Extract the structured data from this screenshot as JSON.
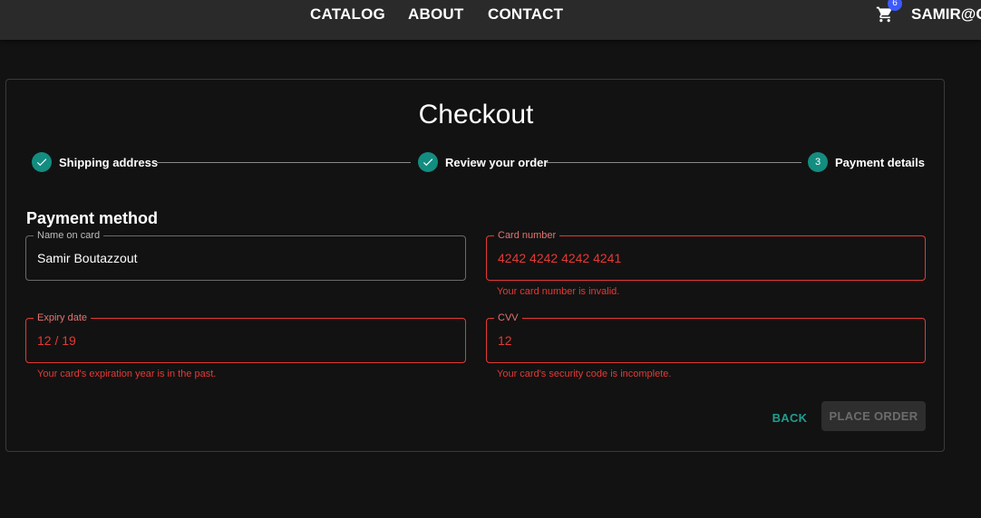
{
  "nav": {
    "links": [
      "CATALOG",
      "ABOUT",
      "CONTACT"
    ],
    "cart_count": "6",
    "cart_icon": "shopping-cart-icon",
    "user": "SAMIR@G"
  },
  "checkout": {
    "title": "Checkout",
    "steps": [
      {
        "label": "Shipping address",
        "state": "completed",
        "icon": "check-icon"
      },
      {
        "label": "Review your order",
        "state": "completed",
        "icon": "check-icon"
      },
      {
        "label": "Payment details",
        "state": "active",
        "number": "3"
      }
    ],
    "section_title": "Payment method",
    "fields": {
      "name": {
        "label": "Name on card",
        "value": "Samir Boutazzout"
      },
      "card_number": {
        "label": "Card number",
        "value": "4242 4242 4242 4241",
        "error": "Your card number is invalid."
      },
      "expiry": {
        "label": "Expiry date",
        "value": "12 / 19",
        "error": "Your card's expiration year is in the past."
      },
      "cvv": {
        "label": "CVV",
        "value": "12",
        "error": "Your card's security code is incomplete."
      }
    },
    "buttons": {
      "back": "BACK",
      "place_order": "PLACE ORDER"
    }
  },
  "colors": {
    "accent": "#138d80",
    "error": "#e53935",
    "badge": "#3d5afe",
    "background": "#121212"
  }
}
